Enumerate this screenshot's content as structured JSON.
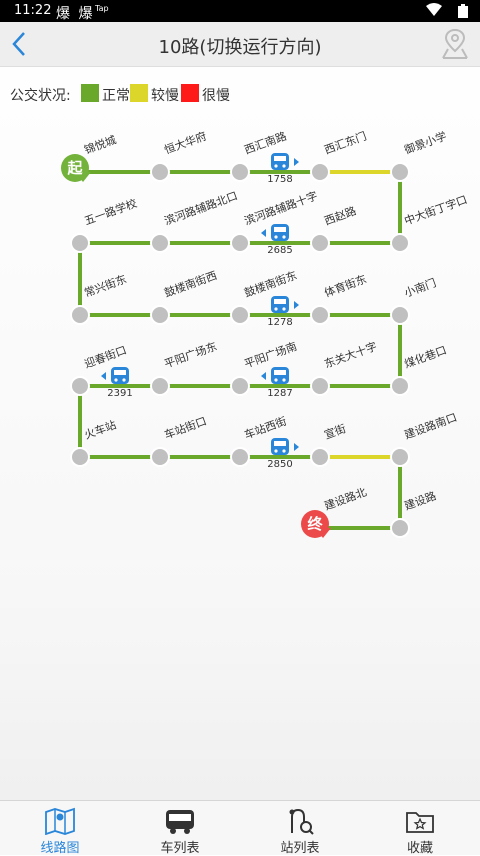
{
  "status_bar": {
    "time": "11:22",
    "notifications": "爆 爆",
    "tap": "Tap"
  },
  "header": {
    "title": "10路(切换运行方向)"
  },
  "legend": {
    "title": "公交状况:",
    "items": [
      {
        "label": "正常",
        "color": "#6aa82c"
      },
      {
        "label": "较慢",
        "color": "#dcd62a"
      },
      {
        "label": "很慢",
        "color": "#ff1a1a"
      }
    ]
  },
  "route": {
    "start_badge": "起",
    "end_badge": "终",
    "stations": [
      "锦悦城",
      "恒大华府",
      "西汇南路",
      "西汇东门",
      "御景小学",
      "中大街丁字口",
      "西赵路",
      "滨河路辅路十字",
      "滨河路辅路北口",
      "五一路学校",
      "常兴街东",
      "鼓楼南街西",
      "鼓楼南街东",
      "体育街东",
      "小南门",
      "煤化巷口",
      "东关大十字",
      "平阳广场南",
      "平阳广场东",
      "迎春街口",
      "火车站",
      "车站街口",
      "车站西街",
      "宣街",
      "建设路南口",
      "建设路",
      "建设路北"
    ],
    "segment_status": [
      "正常",
      "正常",
      "正常",
      "较慢",
      "正常",
      "正常",
      "正常",
      "正常",
      "正常",
      "正常",
      "正常",
      "正常",
      "正常",
      "正常",
      "正常",
      "正常",
      "正常",
      "正常",
      "正常",
      "正常",
      "正常",
      "正常",
      "正常",
      "较慢",
      "正常",
      "正常"
    ],
    "buses": [
      {
        "number": "1758",
        "after_station": 2
      },
      {
        "number": "2685",
        "after_station": 6
      },
      {
        "number": "1278",
        "after_station": 12
      },
      {
        "number": "1287",
        "after_station": 16
      },
      {
        "number": "2391",
        "after_station": 18
      },
      {
        "number": "2850",
        "after_station": 22
      }
    ]
  },
  "tabs": [
    {
      "label": "线路图",
      "icon": "map-icon",
      "active": true
    },
    {
      "label": "车列表",
      "icon": "bus-icon",
      "active": false
    },
    {
      "label": "站列表",
      "icon": "route-search-icon",
      "active": false
    },
    {
      "label": "收藏",
      "icon": "favorites-folder-icon",
      "active": false
    }
  ]
}
